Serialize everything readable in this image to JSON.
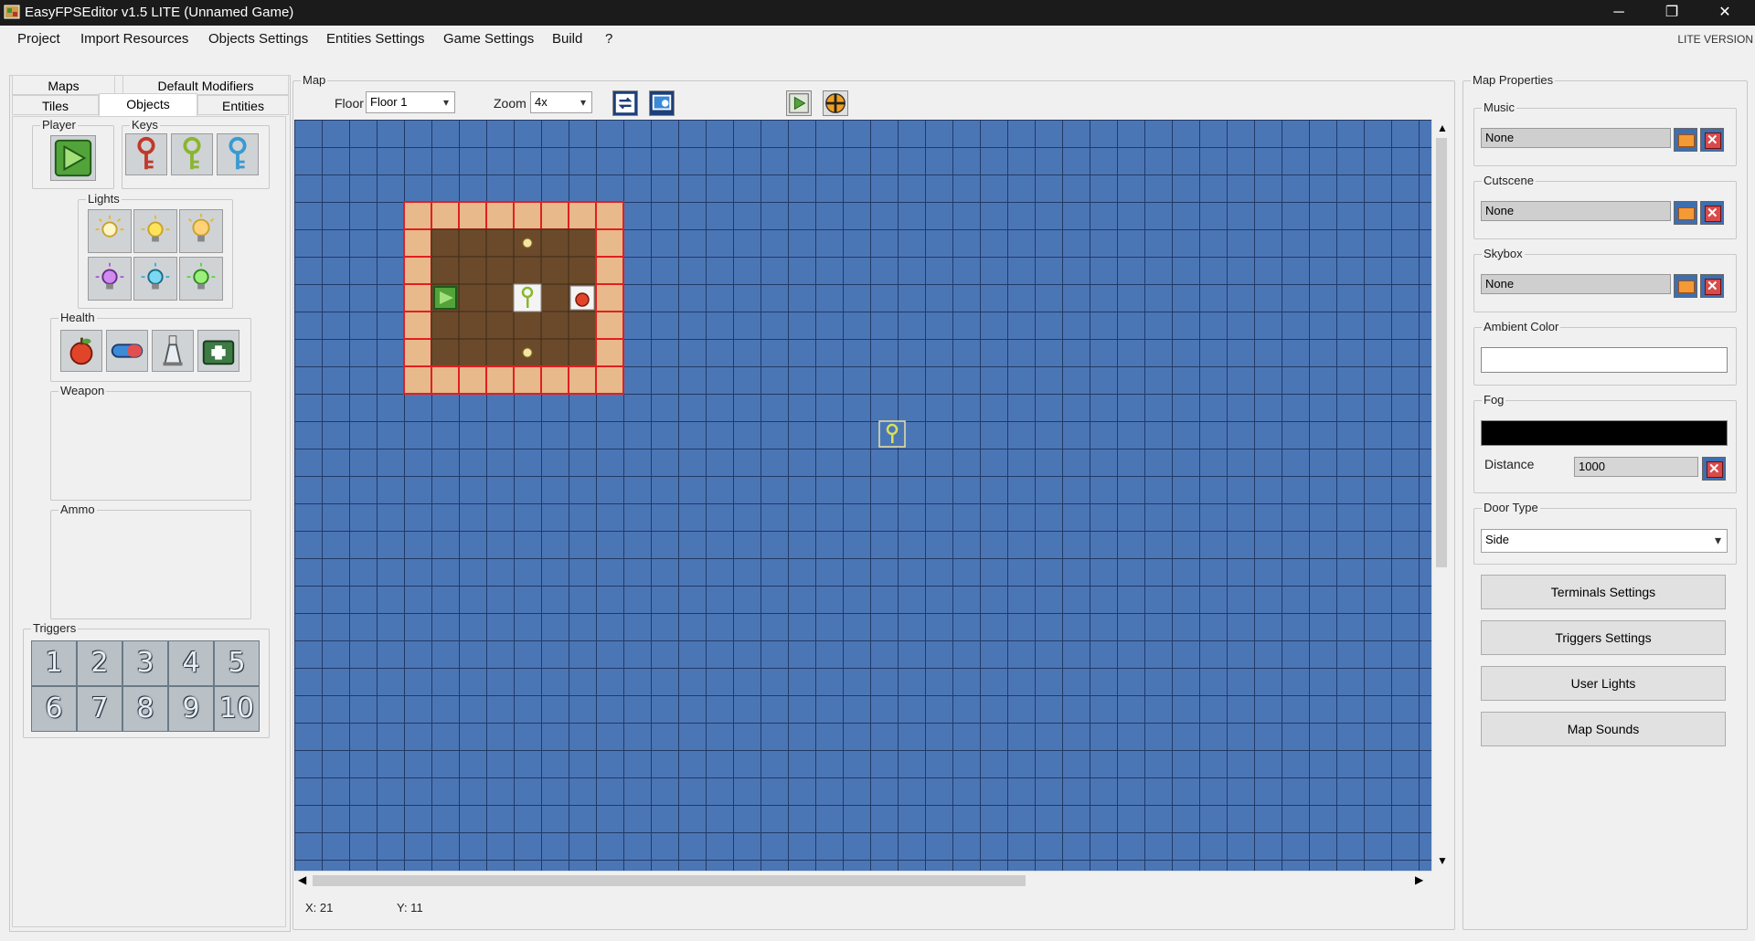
{
  "window": {
    "title": "EasyFPSEditor v1.5 LITE (Unnamed Game)",
    "minimize": "─",
    "maximize": "❐",
    "close": "✕"
  },
  "menu": {
    "items": [
      "Project",
      "Import Resources",
      "Objects Settings",
      "Entities Settings",
      "Game Settings",
      "Build",
      "?"
    ],
    "edition": "LITE VERSION"
  },
  "left": {
    "tabs_row1": [
      "Maps",
      "Default Modifiers"
    ],
    "tabs_row2": [
      "Tiles",
      "Objects",
      "Entities"
    ],
    "active_tab": "Objects",
    "groups": {
      "player": "Player",
      "keys": "Keys",
      "lights": "Lights",
      "health": "Health",
      "weapon": "Weapon",
      "ammo": "Ammo",
      "triggers": "Triggers"
    },
    "triggers": [
      "1",
      "2",
      "3",
      "4",
      "5",
      "6",
      "7",
      "8",
      "9",
      "10"
    ]
  },
  "map": {
    "group": "Map",
    "floor_label": "Floor",
    "floor_value": "Floor 1",
    "zoom_label": "Zoom",
    "zoom_value": "4x",
    "status_x": "X: 21",
    "status_y": "Y: 11"
  },
  "props": {
    "group": "Map Properties",
    "music": {
      "label": "Music",
      "value": "None"
    },
    "cutscene": {
      "label": "Cutscene",
      "value": "None"
    },
    "skybox": {
      "label": "Skybox",
      "value": "None"
    },
    "ambient": {
      "label": "Ambient Color",
      "color": "#ffffff"
    },
    "fog": {
      "label": "Fog",
      "color": "#000000",
      "distance_label": "Distance",
      "distance_value": "1000"
    },
    "door": {
      "label": "Door Type",
      "value": "Side"
    },
    "buttons": [
      "Terminals Settings",
      "Triggers Settings",
      "User Lights",
      "Map Sounds"
    ]
  },
  "colors": {
    "map_bg": "#4b76b6",
    "wall": "#e8b98a",
    "floor": "#6b4a2b",
    "wall_border": "#e02020"
  }
}
